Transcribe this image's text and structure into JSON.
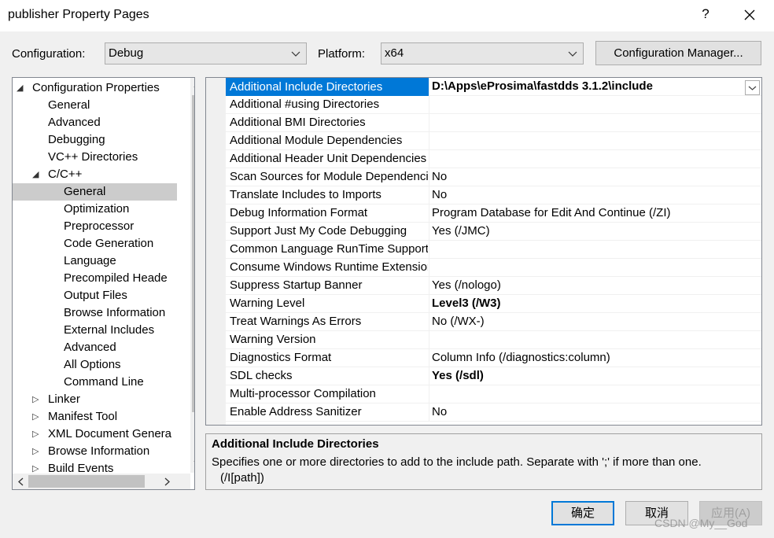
{
  "window": {
    "title": "publisher Property Pages",
    "help": "?",
    "close_icon": "close-icon"
  },
  "config_row": {
    "configuration_label": "Configuration:",
    "configuration_value": "Debug",
    "platform_label": "Platform:",
    "platform_value": "x64",
    "manager_button": "Configuration Manager..."
  },
  "tree": {
    "items": [
      {
        "label": "Configuration Properties",
        "expander": "expanded",
        "level": 0
      },
      {
        "label": "General",
        "level": 1
      },
      {
        "label": "Advanced",
        "level": 1
      },
      {
        "label": "Debugging",
        "level": 1
      },
      {
        "label": "VC++ Directories",
        "level": 1
      },
      {
        "label": "C/C++",
        "expander": "expanded",
        "level": 1
      },
      {
        "label": "General",
        "level": 2,
        "selected": true
      },
      {
        "label": "Optimization",
        "level": 2
      },
      {
        "label": "Preprocessor",
        "level": 2
      },
      {
        "label": "Code Generation",
        "level": 2
      },
      {
        "label": "Language",
        "level": 2
      },
      {
        "label": "Precompiled Heade",
        "level": 2
      },
      {
        "label": "Output Files",
        "level": 2
      },
      {
        "label": "Browse Information",
        "level": 2
      },
      {
        "label": "External Includes",
        "level": 2
      },
      {
        "label": "Advanced",
        "level": 2
      },
      {
        "label": "All Options",
        "level": 2
      },
      {
        "label": "Command Line",
        "level": 2
      },
      {
        "label": "Linker",
        "expander": "collapsed",
        "level": 1
      },
      {
        "label": "Manifest Tool",
        "expander": "collapsed",
        "level": 1
      },
      {
        "label": "XML Document Genera",
        "expander": "collapsed",
        "level": 1
      },
      {
        "label": "Browse Information",
        "expander": "collapsed",
        "level": 1
      },
      {
        "label": "Build Events",
        "expander": "collapsed",
        "level": 1
      }
    ]
  },
  "grid": {
    "rows": [
      {
        "name": "Additional Include Directories",
        "value": "D:\\Apps\\eProsima\\fastdds 3.1.2\\include",
        "bold": true,
        "selected": true,
        "dropdown": true
      },
      {
        "name": "Additional #using Directories",
        "value": ""
      },
      {
        "name": "Additional BMI Directories",
        "value": ""
      },
      {
        "name": "Additional Module Dependencies",
        "value": ""
      },
      {
        "name": "Additional Header Unit Dependencies",
        "value": ""
      },
      {
        "name": "Scan Sources for Module Dependencies",
        "value": "No"
      },
      {
        "name": "Translate Includes to Imports",
        "value": "No"
      },
      {
        "name": "Debug Information Format",
        "value": "Program Database for Edit And Continue (/ZI)"
      },
      {
        "name": "Support Just My Code Debugging",
        "value": "Yes (/JMC)"
      },
      {
        "name": "Common Language RunTime Support",
        "value": ""
      },
      {
        "name": "Consume Windows Runtime Extension",
        "value": ""
      },
      {
        "name": "Suppress Startup Banner",
        "value": "Yes (/nologo)"
      },
      {
        "name": "Warning Level",
        "value": "Level3 (/W3)",
        "bold": true
      },
      {
        "name": "Treat Warnings As Errors",
        "value": "No (/WX-)"
      },
      {
        "name": "Warning Version",
        "value": ""
      },
      {
        "name": "Diagnostics Format",
        "value": "Column Info (/diagnostics:column)"
      },
      {
        "name": "SDL checks",
        "value": "Yes (/sdl)",
        "bold": true
      },
      {
        "name": "Multi-processor Compilation",
        "value": ""
      },
      {
        "name": "Enable Address Sanitizer",
        "value": "No"
      }
    ]
  },
  "description": {
    "title": "Additional Include Directories",
    "line1": "Specifies one or more directories to add to the include path. Separate with ';' if more than one.",
    "line2": "(/I[path])"
  },
  "buttons": {
    "ok": "确定",
    "cancel": "取消",
    "apply": "应用(A)"
  },
  "watermark": "CSDN @My__God",
  "colors": {
    "selection": "#0078d7",
    "tree_selection": "#cccccc",
    "dialog_bg": "#f0f0f0"
  }
}
